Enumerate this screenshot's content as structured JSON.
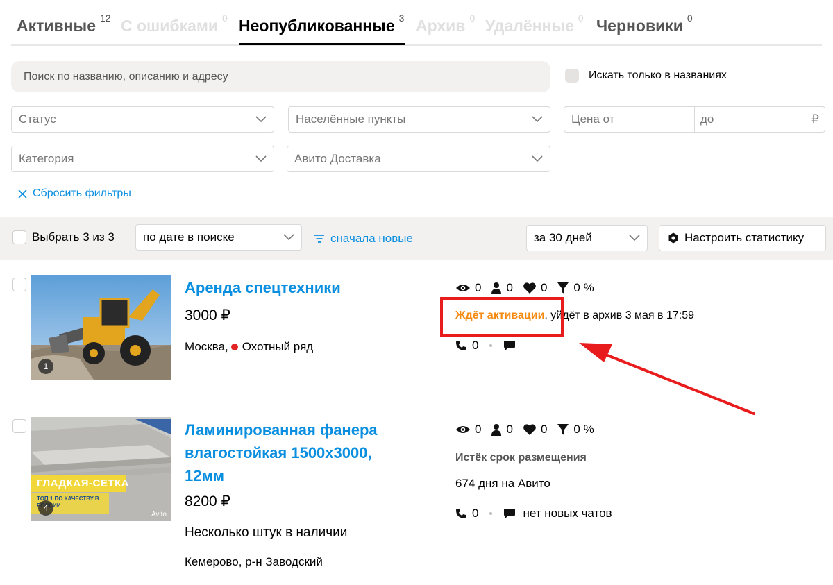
{
  "tabs": [
    {
      "label": "Активные",
      "count": "12",
      "state": "gray"
    },
    {
      "label": "С ошибками",
      "count": "0",
      "state": "muted"
    },
    {
      "label": "Неопубликованные",
      "count": "3",
      "state": "active"
    },
    {
      "label": "Архив",
      "count": "0",
      "state": "muted"
    },
    {
      "label": "Удалённые",
      "count": "0",
      "state": "muted"
    },
    {
      "label": "Черновики",
      "count": "0",
      "state": "gray"
    }
  ],
  "search": {
    "placeholder": "Поиск по названию, описанию и адресу",
    "only_names_label": "Искать только в названиях"
  },
  "filters": {
    "status": "Статус",
    "localities": "Населённые пункты",
    "price_from": "Цена от",
    "price_to": "до",
    "currency": "₽",
    "category": "Категория",
    "delivery": "Авито Доставка",
    "reset_label": "Сбросить фильтры"
  },
  "sortbar": {
    "select_label": "Выбрать 3 из 3",
    "sort_value": "по дате в поиске",
    "order_label": "сначала новые",
    "period_value": "за 30 дней",
    "stats_button": "Настроить статистику"
  },
  "listings": [
    {
      "title": "Аренда спецтехники",
      "price": "3000 ₽",
      "city": "Москва,",
      "metro": "Охотный ряд",
      "photo_count": "1",
      "views": "0",
      "contacts": "0",
      "favorites": "0",
      "conversion": "0 %",
      "status": "Ждёт активации",
      "status_rest": ", уйдёт в архив 3 мая в 17:59",
      "calls": "0"
    },
    {
      "title": "Ламинированная фанера влагостойкая 1500х3000, 12мм",
      "price": "8200 ₽",
      "availability": "Несколько штук в наличии",
      "location": "Кемерово, р-н Заводский",
      "photo_count": "4",
      "views": "0",
      "contacts": "0",
      "favorites": "0",
      "conversion": "0 %",
      "status": "Истёк срок размещения",
      "days": "674 дня на Авито",
      "calls": "0",
      "chats": "нет новых чатов",
      "banner_main": "ГЛАДКАЯ-СЕТКА",
      "banner_sub": "ТОП 1 ПО КАЧЕСТВУ В РОССИИ",
      "watermark": "Avito"
    }
  ],
  "colors": {
    "accent_blue": "#0a8fe0",
    "status_orange": "#f58a10",
    "highlight_red": "#e81c1c"
  }
}
